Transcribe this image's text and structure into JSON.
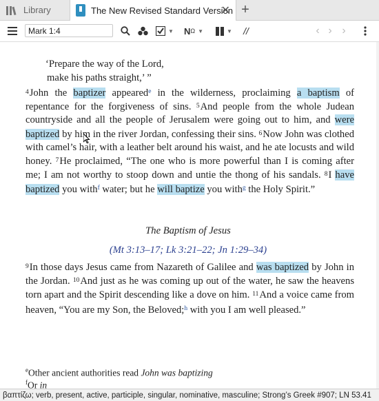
{
  "tabs": {
    "library_label": "Library",
    "active_label": "The New Revised Standard Version",
    "close_glyph": "✕",
    "add_glyph": "+"
  },
  "toolbar": {
    "reference": "Mark 1:4",
    "icons": [
      "menu-icon",
      "search-icon",
      "visual-filters-icon",
      "checklist-icon",
      "interlinear-icon",
      "parallel-icon",
      "panel-layout-icon",
      "back-icon",
      "forward-icon"
    ],
    "divider_glyph": "//"
  },
  "passage": {
    "poem_line1": "‘Prepare the way of the Lord,",
    "poem_line2": "make his paths straight,’ ”",
    "verses_block1": [
      [
        "4",
        "John the "
      ],
      [
        "hl",
        "baptizer"
      ],
      [
        "t",
        " appeared"
      ],
      [
        "fn",
        "e"
      ],
      [
        "t",
        " in the wilderness, proclaiming "
      ],
      [
        "hl",
        "a baptism"
      ],
      [
        "t",
        " of repentance for the forgiveness of sins. "
      ],
      [
        "v",
        "5"
      ],
      [
        "t",
        "And people from the whole Judean countryside and all the people of Jerusalem were going out to him, and "
      ],
      [
        "hl",
        "were baptized"
      ],
      [
        "t",
        " by him in the river Jordan, confessing their sins. "
      ],
      [
        "v",
        "6"
      ],
      [
        "t",
        "Now John was clothed with camel’s hair, with a leather belt around his waist, and he ate locusts and wild honey. "
      ],
      [
        "v",
        "7"
      ],
      [
        "t",
        "He proclaimed, “The one who is more powerful than I is coming after me; I am not worthy to stoop down and untie the thong of his sandals. "
      ],
      [
        "v",
        "8"
      ],
      [
        "t",
        "I "
      ],
      [
        "hl",
        "have baptized"
      ],
      [
        "t",
        " you with"
      ],
      [
        "fn",
        "f"
      ],
      [
        "t",
        " water; but he "
      ],
      [
        "hl",
        "will baptize"
      ],
      [
        "t",
        " you with"
      ],
      [
        "fn",
        "g"
      ],
      [
        "t",
        " the Holy Spirit.”"
      ]
    ],
    "heading": "The Baptism of Jesus",
    "xref": "(Mt 3:13–17; Lk 3:21–22; Jn 1:29–34)",
    "verses_block2": [
      [
        "v",
        "9"
      ],
      [
        "t",
        "In those days Jesus came from Nazareth of Galilee and "
      ],
      [
        "hl",
        "was baptized"
      ],
      [
        "t",
        " by John in the Jordan. "
      ],
      [
        "v",
        "10"
      ],
      [
        "t",
        "And just as he was coming up out of the water, he saw the heavens torn apart and the Spirit descending like a dove on him. "
      ],
      [
        "v",
        "11"
      ],
      [
        "t",
        "And a voice came from heaven, “You are my Son, the Beloved;"
      ],
      [
        "fn",
        "h"
      ],
      [
        "t",
        " with you I am well pleased.”"
      ]
    ],
    "footnote_e_marker": "e",
    "footnote_e_text": "Other ancient authorities read ",
    "footnote_e_italic": "John was baptizing",
    "footnote_f_marker": "f",
    "footnote_f_text": "Or ",
    "footnote_f_italic": "in"
  },
  "status": {
    "text": "βαπτίζω; verb, present, active, participle, singular, nominative, masculine; Strong’s Greek #907; LN 53.41"
  },
  "colors": {
    "highlight": "#b8def0",
    "accent_blue": "#2f8fbf",
    "xref": "#2a3f8f"
  }
}
